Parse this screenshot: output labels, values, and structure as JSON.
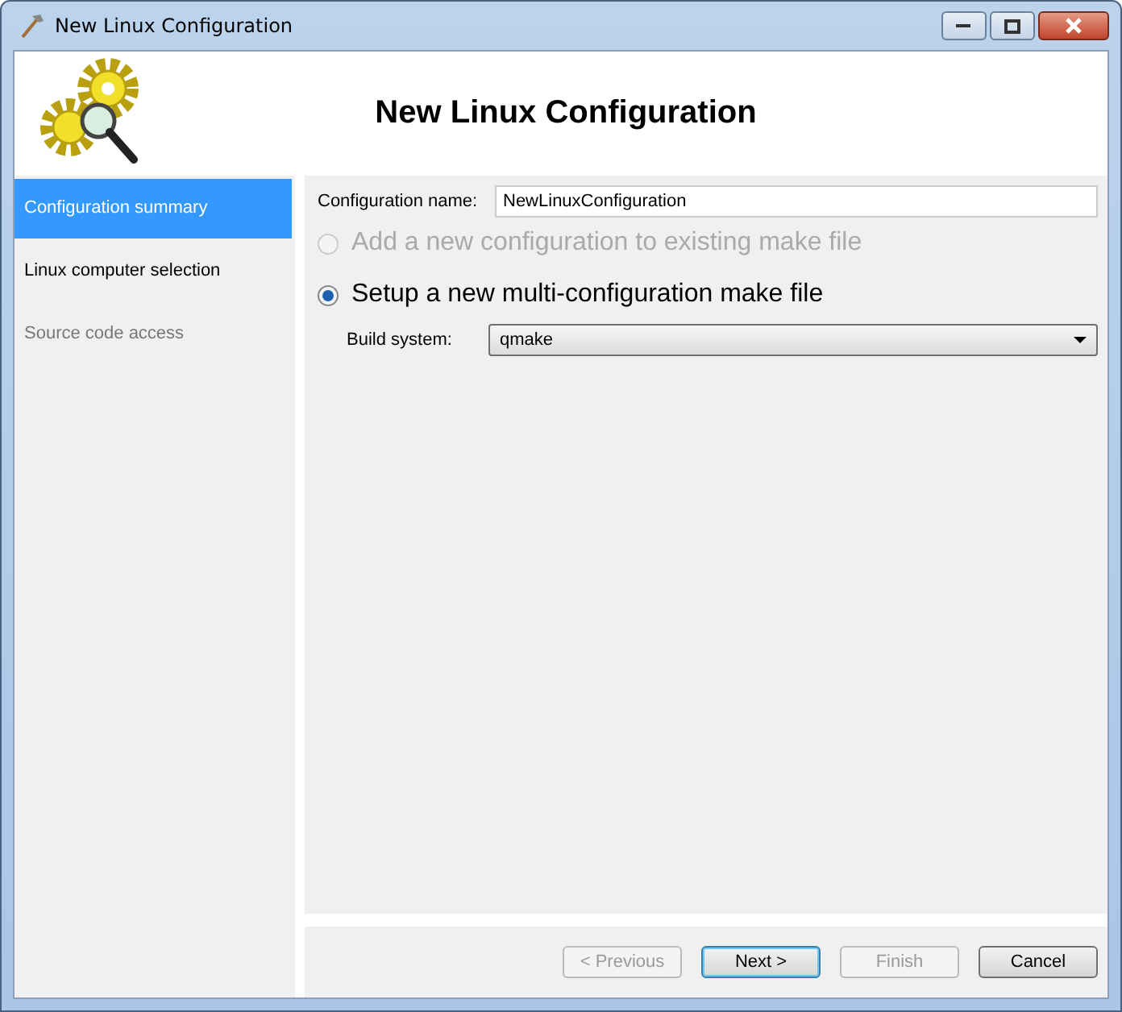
{
  "window": {
    "title": "New Linux Configuration"
  },
  "header": {
    "title": "New Linux Configuration"
  },
  "sidebar": {
    "items": [
      {
        "label": "Configuration summary",
        "selected": true,
        "disabled": false
      },
      {
        "label": "Linux computer selection",
        "selected": false,
        "disabled": false
      },
      {
        "label": "Source code access",
        "selected": false,
        "disabled": true
      }
    ]
  },
  "form": {
    "config_name": {
      "label": "Configuration name:",
      "value": "NewLinuxConfiguration"
    },
    "options": [
      {
        "label": "Add a new configuration to existing make file",
        "selected": false,
        "disabled": true
      },
      {
        "label": "Setup a new multi-configuration make file",
        "selected": true,
        "disabled": false
      }
    ],
    "build_system": {
      "label": "Build system:",
      "value": "qmake"
    }
  },
  "buttons": [
    {
      "label": "< Previous",
      "disabled": true,
      "default": false
    },
    {
      "label": "Next >",
      "disabled": false,
      "default": true
    },
    {
      "label": "Finish",
      "disabled": true,
      "default": false
    },
    {
      "label": "Cancel",
      "disabled": false,
      "default": false
    }
  ]
}
